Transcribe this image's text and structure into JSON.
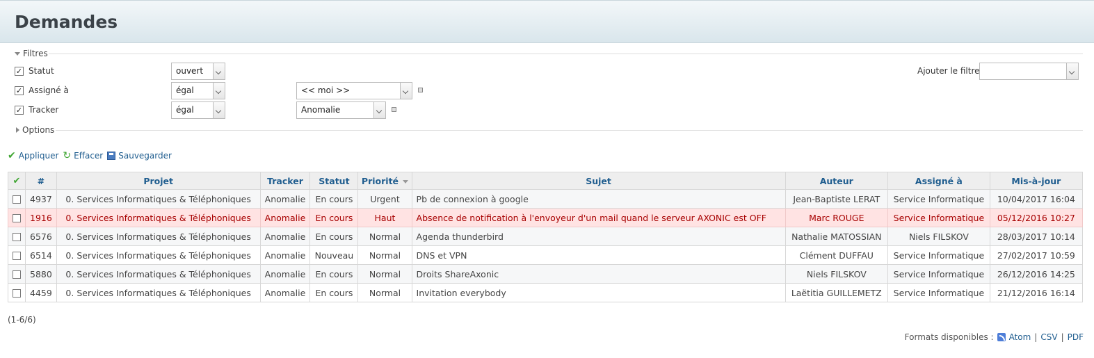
{
  "page": {
    "title": "Demandes"
  },
  "filters": {
    "legend": "Filtres",
    "rows": [
      {
        "label": "Statut",
        "operator": "ouvert",
        "value": ""
      },
      {
        "label": "Assigné à",
        "operator": "égal",
        "value": "<< moi >>"
      },
      {
        "label": "Tracker",
        "operator": "égal",
        "value": "Anomalie"
      }
    ],
    "add_filter_label": "Ajouter le filtre",
    "add_filter_value": ""
  },
  "options": {
    "legend": "Options"
  },
  "actions": {
    "apply": "Appliquer",
    "clear": "Effacer",
    "save": "Sauvegarder"
  },
  "table": {
    "columns": [
      "#",
      "Projet",
      "Tracker",
      "Statut",
      "Priorité",
      "Sujet",
      "Auteur",
      "Assigné à",
      "Mis-à-jour"
    ],
    "rows": [
      {
        "id": "4937",
        "project": "0. Services Informatiques & Téléphoniques",
        "tracker": "Anomalie",
        "status": "En cours",
        "priority": "Urgent",
        "subject": "Pb de connexion à google",
        "author": "Jean-Baptiste LERAT",
        "assignee": "Service Informatique",
        "updated": "10/04/2017 16:04"
      },
      {
        "id": "1916",
        "project": "0. Services Informatiques & Téléphoniques",
        "tracker": "Anomalie",
        "status": "En cours",
        "priority": "Haut",
        "subject": "Absence de notification à l'envoyeur d'un mail quand le serveur AXONIC est OFF",
        "author": "Marc ROUGE",
        "assignee": "Service Informatique",
        "updated": "05/12/2016 10:27"
      },
      {
        "id": "6576",
        "project": "0. Services Informatiques & Téléphoniques",
        "tracker": "Anomalie",
        "status": "En cours",
        "priority": "Normal",
        "subject": "Agenda thunderbird",
        "author": "Nathalie MATOSSIAN",
        "assignee": "Niels FILSKOV",
        "updated": "28/03/2017 10:14"
      },
      {
        "id": "6514",
        "project": "0. Services Informatiques & Téléphoniques",
        "tracker": "Anomalie",
        "status": "Nouveau",
        "priority": "Normal",
        "subject": "DNS et VPN",
        "author": "Clément DUFFAU",
        "assignee": "Service Informatique",
        "updated": "27/02/2017 10:59"
      },
      {
        "id": "5880",
        "project": "0. Services Informatiques & Téléphoniques",
        "tracker": "Anomalie",
        "status": "En cours",
        "priority": "Normal",
        "subject": "Droits ShareAxonic",
        "author": "Niels FILSKOV",
        "assignee": "Service Informatique",
        "updated": "26/12/2016 14:25"
      },
      {
        "id": "4459",
        "project": "0. Services Informatiques & Téléphoniques",
        "tracker": "Anomalie",
        "status": "En cours",
        "priority": "Normal",
        "subject": "Invitation everybody",
        "author": "Laëtitia GUILLEMETZ",
        "assignee": "Service Informatique",
        "updated": "21/12/2016 16:14"
      }
    ]
  },
  "pagination": "(1-6/6)",
  "formats": {
    "label": "Formats disponibles :",
    "atom": "Atom",
    "csv": "CSV",
    "pdf": "PDF",
    "sep": "|"
  },
  "colors": {
    "link": "#1f5d8f",
    "highlight_bg": "#ffe3e3",
    "highlight_text": "#a70000"
  }
}
